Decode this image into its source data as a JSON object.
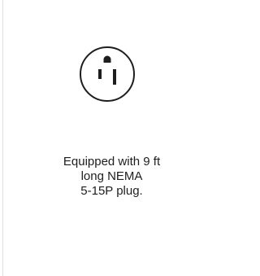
{
  "feature": {
    "icon": "nema-5-15-outlet-icon",
    "caption_lines": [
      "Equipped with 9 ft",
      "long NEMA",
      "5-15P plug."
    ],
    "colors": {
      "icon": "#1e1e1e",
      "text": "#1e1e1e",
      "divider": "#dedede"
    }
  }
}
